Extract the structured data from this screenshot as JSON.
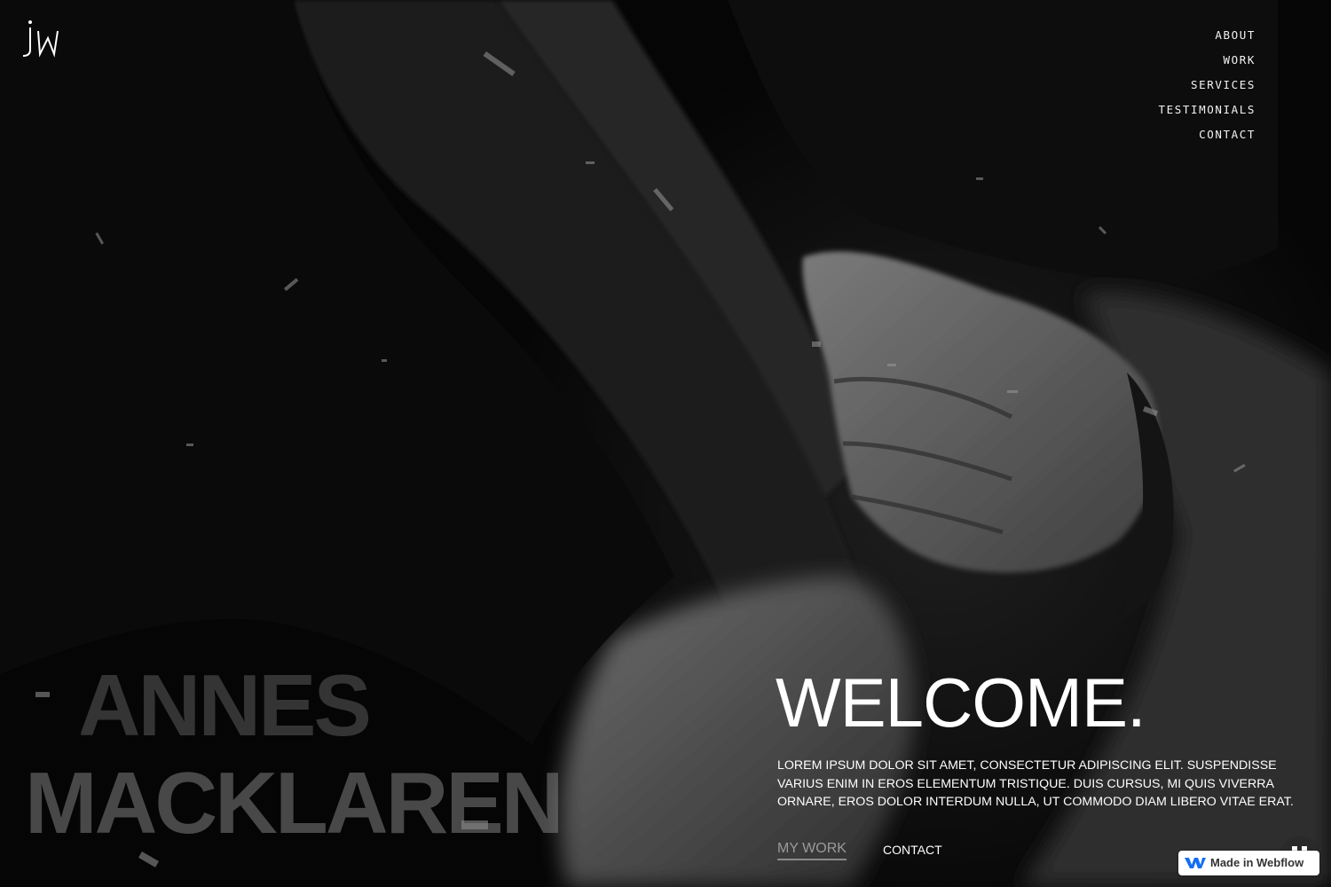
{
  "logo": {
    "text": "jW"
  },
  "nav": {
    "items": [
      {
        "label": "ABOUT"
      },
      {
        "label": "WORK"
      },
      {
        "label": "SERVICES"
      },
      {
        "label": "TESTIMONIALS"
      },
      {
        "label": "CONTACT"
      }
    ]
  },
  "hero": {
    "name_first": "HANNES",
    "name_last": "MACKLAREN",
    "title": "WELCOME.",
    "intro": "LOREM IPSUM DOLOR SIT AMET, CONSECTETUR ADIPISCING ELIT. SUSPENDISSE VARIUS ENIM IN EROS ELEMENTUM TRISTIQUE. DUIS CURSUS, MI QUIS VIVERRA ORNARE, EROS DOLOR INTERDUM NULLA, UT COMMODO DIAM LIBERO VITAE ERAT.",
    "cta_work": "MY WORK",
    "cta_contact": "CONTACT"
  },
  "badge": {
    "label": "Made in Webflow"
  },
  "colors": {
    "background": "#050505",
    "text": "#ffffff",
    "muted_link": "#9a9a9a",
    "webflow_blue": "#146ef5"
  }
}
